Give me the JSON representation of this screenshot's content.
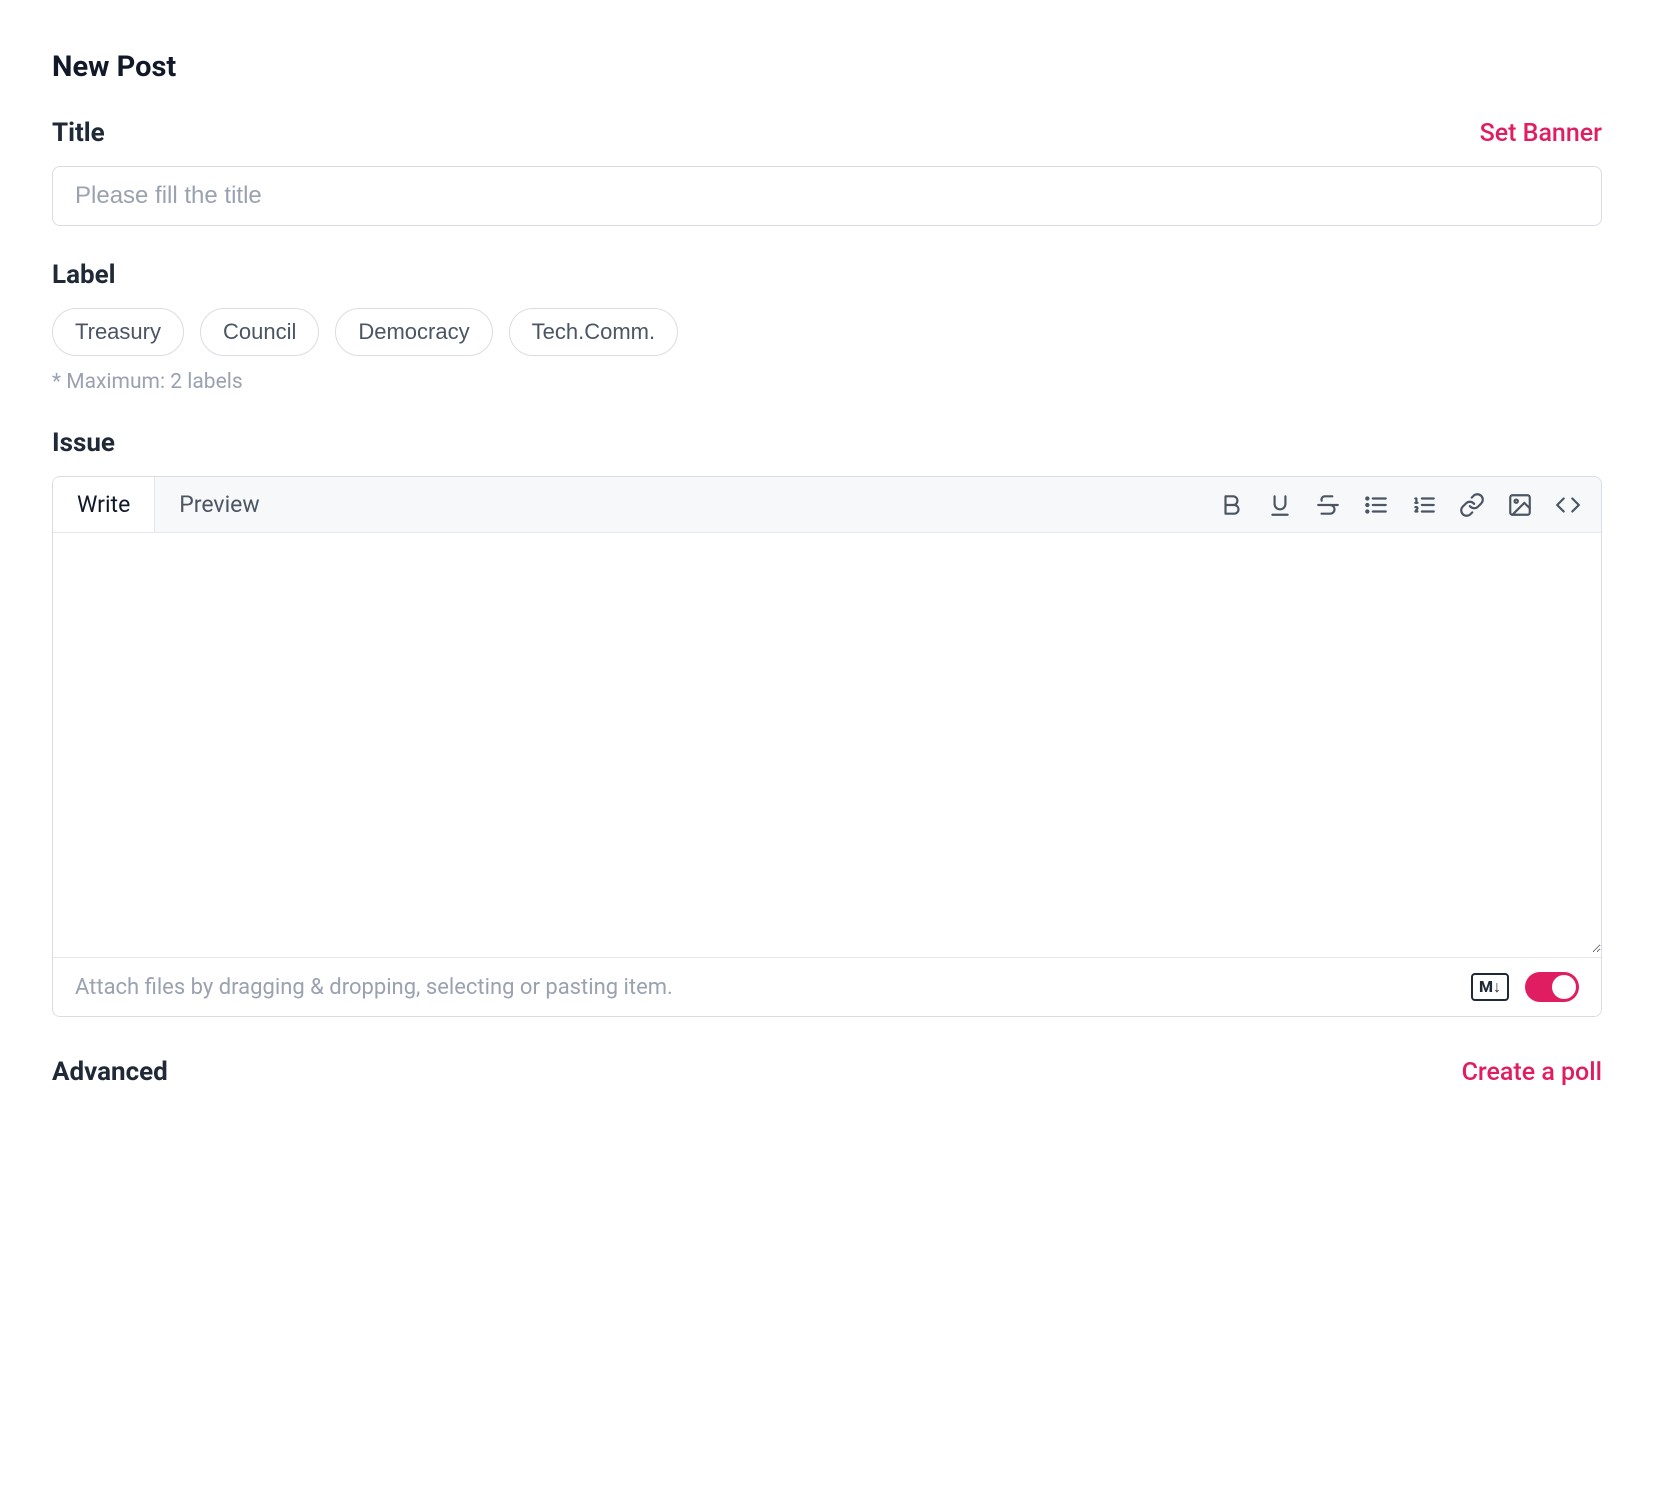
{
  "page_title": "New Post",
  "accent": "#e11d62",
  "title_section": {
    "label": "Title",
    "set_banner": "Set Banner",
    "placeholder": "Please fill the title",
    "value": ""
  },
  "label_section": {
    "label": "Label",
    "options": [
      "Treasury",
      "Council",
      "Democracy",
      "Tech.Comm."
    ],
    "hint": "* Maximum: 2 labels"
  },
  "issue_section": {
    "label": "Issue",
    "tabs": {
      "write": "Write",
      "preview": "Preview"
    },
    "active_tab": "write",
    "toolbar_icons": [
      "bold",
      "underline",
      "strikethrough",
      "bullet-list",
      "ordered-list",
      "link",
      "image",
      "code"
    ],
    "body_value": "",
    "attach_hint": "Attach files by dragging & dropping, selecting or pasting item.",
    "markdown_badge": "M↓",
    "toggle_on": true
  },
  "advanced_section": {
    "label": "Advanced",
    "create_poll": "Create a poll"
  }
}
